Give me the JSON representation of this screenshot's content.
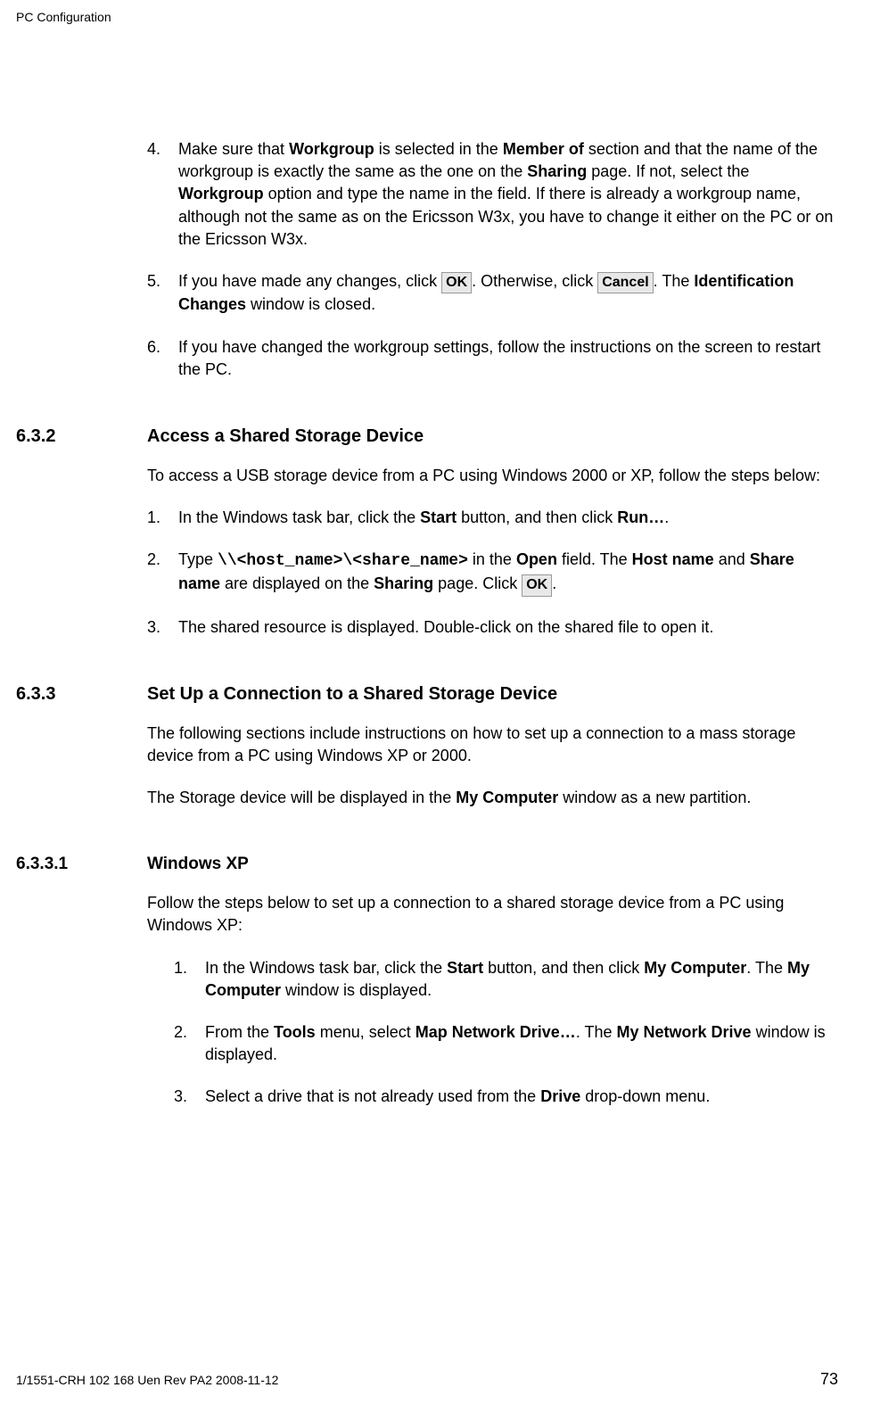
{
  "header": "PC Configuration",
  "list1": {
    "item4": {
      "num": "4.",
      "t1": "Make sure that ",
      "b1": "Workgroup",
      "t2": " is selected in the ",
      "b2": "Member of",
      "t3": " section and that the name of the workgroup is exactly the same as the one on the ",
      "b3": "Sharing",
      "t4": " page. If not, select the ",
      "b4": "Workgroup",
      "t5": " option and type the name in the field. If there is already a workgroup name, although not the same as on the Ericsson W3x, you have to change it either on the PC or on the Ericsson W3x."
    },
    "item5": {
      "num": "5.",
      "t1": "If you have made any changes, click ",
      "btn1": "OK",
      "t2": ". Otherwise, click ",
      "btn2": "Cancel",
      "t3": ". The ",
      "b1": "Identification Changes",
      "t4": " window is closed."
    },
    "item6": {
      "num": "6.",
      "t1": "If you have changed the workgroup settings, follow the instructions on the screen to restart the PC."
    }
  },
  "sec632": {
    "num": "6.3.2",
    "title": "Access a Shared Storage Device",
    "intro": "To access a USB storage device from a PC using Windows 2000 or XP, follow the steps below:",
    "item1": {
      "num": "1.",
      "t1": "In the Windows task bar, click the ",
      "b1": "Start",
      "t2": " button, and then click ",
      "b2": "Run…",
      "t3": "."
    },
    "item2": {
      "num": "2.",
      "t1": "Type ",
      "code": "\\\\<host_name>\\<share_name>",
      "t2": " in the ",
      "b1": "Open",
      "t3": " field. The ",
      "b2": "Host name",
      "t4": " and ",
      "b3": "Share name",
      "t5": " are displayed on the ",
      "b4": "Sharing",
      "t6": " page. Click ",
      "btn1": "OK",
      "t7": "."
    },
    "item3": {
      "num": "3.",
      "t1": "The shared resource is displayed. Double-click on the shared file to open it."
    }
  },
  "sec633": {
    "num": "6.3.3",
    "title": "Set Up a Connection to a Shared Storage Device",
    "p1": "The following sections include instructions on how to set up a connection to a mass storage device from a PC using Windows XP or 2000.",
    "p2a": "The Storage device will be displayed in the ",
    "p2b": "My Computer",
    "p2c": " window as a new partition."
  },
  "sec6331": {
    "num": "6.3.3.1",
    "title": "Windows XP",
    "intro": "Follow the steps below to set up a connection to a shared storage device from a PC using Windows XP:",
    "item1": {
      "num": "1.",
      "t1": "In the Windows task bar, click the ",
      "b1": "Start",
      "t2": " button, and then click ",
      "b2": "My Computer",
      "t3": ". The ",
      "b3": "My Computer",
      "t4": " window is displayed."
    },
    "item2": {
      "num": "2.",
      "t1": "From the ",
      "b1": "Tools",
      "t2": " menu, select ",
      "b2": "Map Network Drive…",
      "t3": ". The ",
      "b3": "My Network Drive",
      "t4": " window is displayed."
    },
    "item3": {
      "num": "3.",
      "t1": "Select a drive that is not already used from the ",
      "b1": "Drive",
      "t2": " drop-down menu."
    }
  },
  "footer": {
    "docid": "1/1551-CRH 102 168 Uen Rev PA2  2008-11-12",
    "page": "73"
  }
}
